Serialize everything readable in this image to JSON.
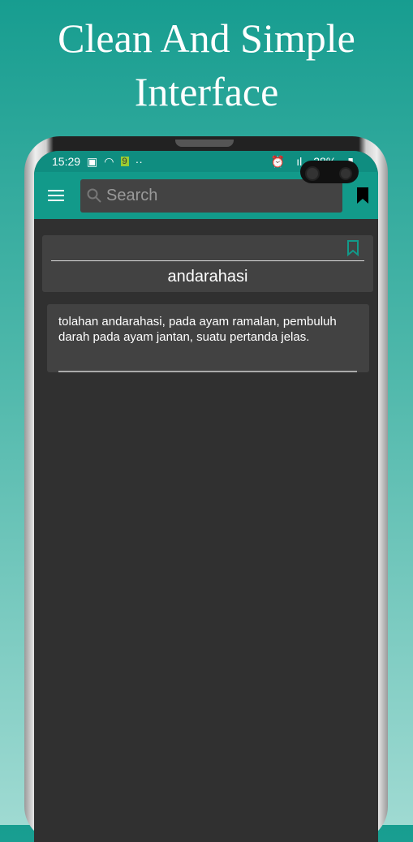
{
  "headline": {
    "line1": "Clean And Simple",
    "line2": "Interface"
  },
  "status_bar": {
    "time": "15:29",
    "battery": "28%"
  },
  "toolbar": {
    "search_placeholder": "Search",
    "menu_icon": "hamburger-icon",
    "bookmarks_icon": "bookmark-icon"
  },
  "entry": {
    "word": "andarahasi",
    "definition": "tolahan andarahasi, pada ayam ramalan, pembuluh darah pada ayam jantan, suatu pertanda jelas."
  },
  "colors": {
    "accent": "#129a8a",
    "background": "#303030",
    "card": "#424242"
  }
}
